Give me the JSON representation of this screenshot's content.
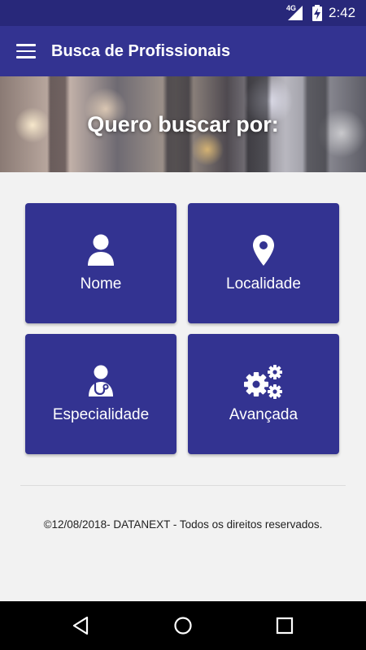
{
  "status_bar": {
    "network": "4G",
    "time": "2:42"
  },
  "app_bar": {
    "title": "Busca de Profissionais",
    "menu_icon": "hamburger-menu-icon"
  },
  "banner": {
    "heading": "Quero buscar por:"
  },
  "tiles": [
    {
      "label": "Nome",
      "icon": "user-icon"
    },
    {
      "label": "Localidade",
      "icon": "map-pin-icon"
    },
    {
      "label": "Especialidade",
      "icon": "doctor-stethoscope-icon"
    },
    {
      "label": "Avançada",
      "icon": "gears-icon"
    }
  ],
  "footer": {
    "text": "©12/08/2018- DATANEXT - Todos os direitos reservados."
  },
  "colors": {
    "primary": "#333391",
    "status_bar": "#28287a",
    "background": "#f2f2f2"
  },
  "nav_bar": {
    "icons": [
      "back-icon",
      "home-icon",
      "recents-icon"
    ]
  }
}
